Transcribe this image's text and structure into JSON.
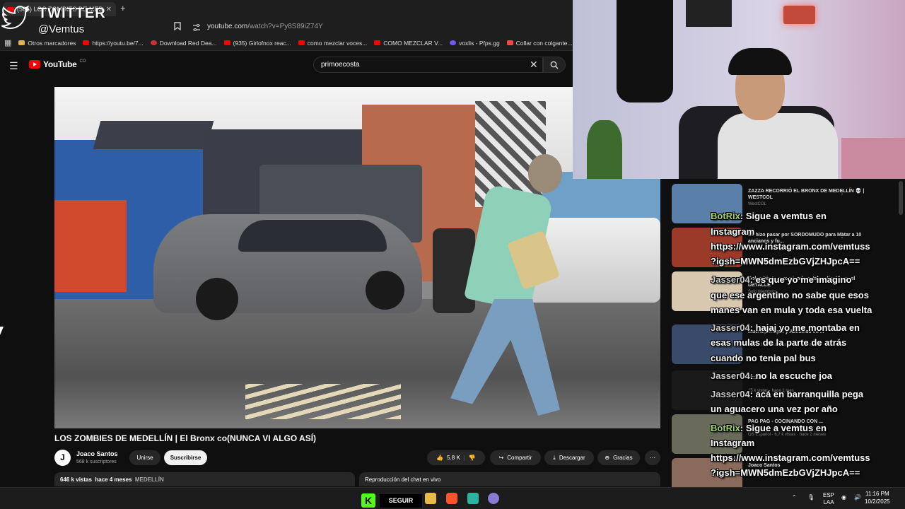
{
  "browser": {
    "tab_title": "(565) LOS ZOMBIES DE MEDE",
    "new_tab": "+",
    "url_host": "youtube.com",
    "url_path": "/watch?v=Py8S89iZ74Y",
    "bookmarks": [
      {
        "label": "Otros marcadores",
        "color": "#e0b44a"
      },
      {
        "label": "https://youtu.be/7...",
        "color": "#ff0000"
      },
      {
        "label": "Download Red Dea...",
        "color": "#cc3333"
      },
      {
        "label": "(935) Girlofnox reac...",
        "color": "#ff0000"
      },
      {
        "label": "como mezclar voces...",
        "color": "#ff0000"
      },
      {
        "label": "COMO MEZCLAR V...",
        "color": "#ff0000"
      },
      {
        "label": "voxlis - Pfps.gg",
        "color": "#6b5bff"
      },
      {
        "label": "Collar con colgante...",
        "color": "#ff4444"
      }
    ]
  },
  "overlay": {
    "twitter_label": "TWITTER",
    "twitter_handle": "@Vemtus"
  },
  "youtube": {
    "logo": "YouTube",
    "logo_country": "CO",
    "search_value": "primoecosta",
    "video_title": "LOS ZOMBIES DE MEDELLÍN | El Bronx co(NUNCA VI ALGO ASÍ)",
    "channel_initial": "J",
    "channel_name": "Joaco Santos",
    "channel_subs": "568 k suscriptores",
    "join_label": "Unirse",
    "subscribe_label": "Suscribirse",
    "likes": "5.8 K",
    "share_label": "Compartir",
    "download_label": "Descargar",
    "thanks_label": "Gracias",
    "views": "646 k vistas",
    "age": "hace 4 meses",
    "hashtag": "MEDELLÍN",
    "chat_replay_label": "Reproducción del chat en vivo"
  },
  "sidebar": {
    "recommendations": [
      {
        "title": "ZAZZA RECORRIÓ EL BRONX DE MEDELLÍN 💀 | WESTCOL",
        "meta": "WestCOL",
        "thumb_color": "#5a7fa8"
      },
      {
        "title": "Se hizo pasar por SORDOMUDO para Matar a 10 ancianos y fu...",
        "meta": "",
        "thumb_color": "#9c3a2a"
      },
      {
        "title": "Colombia te recomiendo estas películas en el DETALLE",
        "meta": "Solo miembros",
        "thumb_color": "#d8c8b0"
      },
      {
        "title": "Muerte, Drogas y Asesinos en ...",
        "meta": "8,4 M de vistas · hace 2 semanas",
        "thumb_color": "#3a4a6a"
      },
      {
        "title": "Pt:16",
        "meta": "15 k vistas · hace 1 mes",
        "thumb_color": "#1a1a1a"
      },
      {
        "title": "PAG PAG - COCINANDO CON ...",
        "meta": "OS Español · 6,7 k vistas · hace 2 meses",
        "thumb_color": "#6a6a5a"
      },
      {
        "title": "Joaco Santos",
        "meta": "",
        "thumb_color": "#8a6a5a"
      }
    ]
  },
  "chat": {
    "lines": [
      {
        "user": "BotRix",
        "text": ": Sigue a vemtus en"
      },
      {
        "user": "",
        "text": "Instagram"
      },
      {
        "user": "",
        "text": "https://www.instagram.com/vemtuss"
      },
      {
        "user": "",
        "text": "?igsh=MWN5dmEzbGVjZHJpcA=="
      },
      {
        "user": "Jasser04",
        "text": ": es que yo me imagino"
      },
      {
        "user": "",
        "text": "que ese argentino no sabe que esos"
      },
      {
        "user": "",
        "text": "manes van en mula y toda esa vuelta"
      },
      {
        "user": "Jasser04",
        "text": ": hajaj yo me montaba en"
      },
      {
        "user": "",
        "text": "esas mulas de la parte de atrás"
      },
      {
        "user": "",
        "text": "cuando no tenia pal bus"
      },
      {
        "user": "Jasser04",
        "text": ": no la escuche joa"
      },
      {
        "user": "Jasser04",
        "text": ": acá en barranquilla pega"
      },
      {
        "user": "",
        "text": "un aguacero una vez por año"
      },
      {
        "user": "BotRix",
        "text": ": Sigue a vemtus en"
      },
      {
        "user": "",
        "text": "Instagram"
      },
      {
        "user": "",
        "text": "https://www.instagram.com/vemtuss"
      },
      {
        "user": "",
        "text": "?igsh=MWN5dmEzbGVjZHJpcA=="
      }
    ]
  },
  "taskbar": {
    "follow_label": "SEGUIR",
    "lang_line1": "ESP",
    "lang_line2": "LAA",
    "time": "11:16 PM",
    "date": "10/2/2025"
  }
}
